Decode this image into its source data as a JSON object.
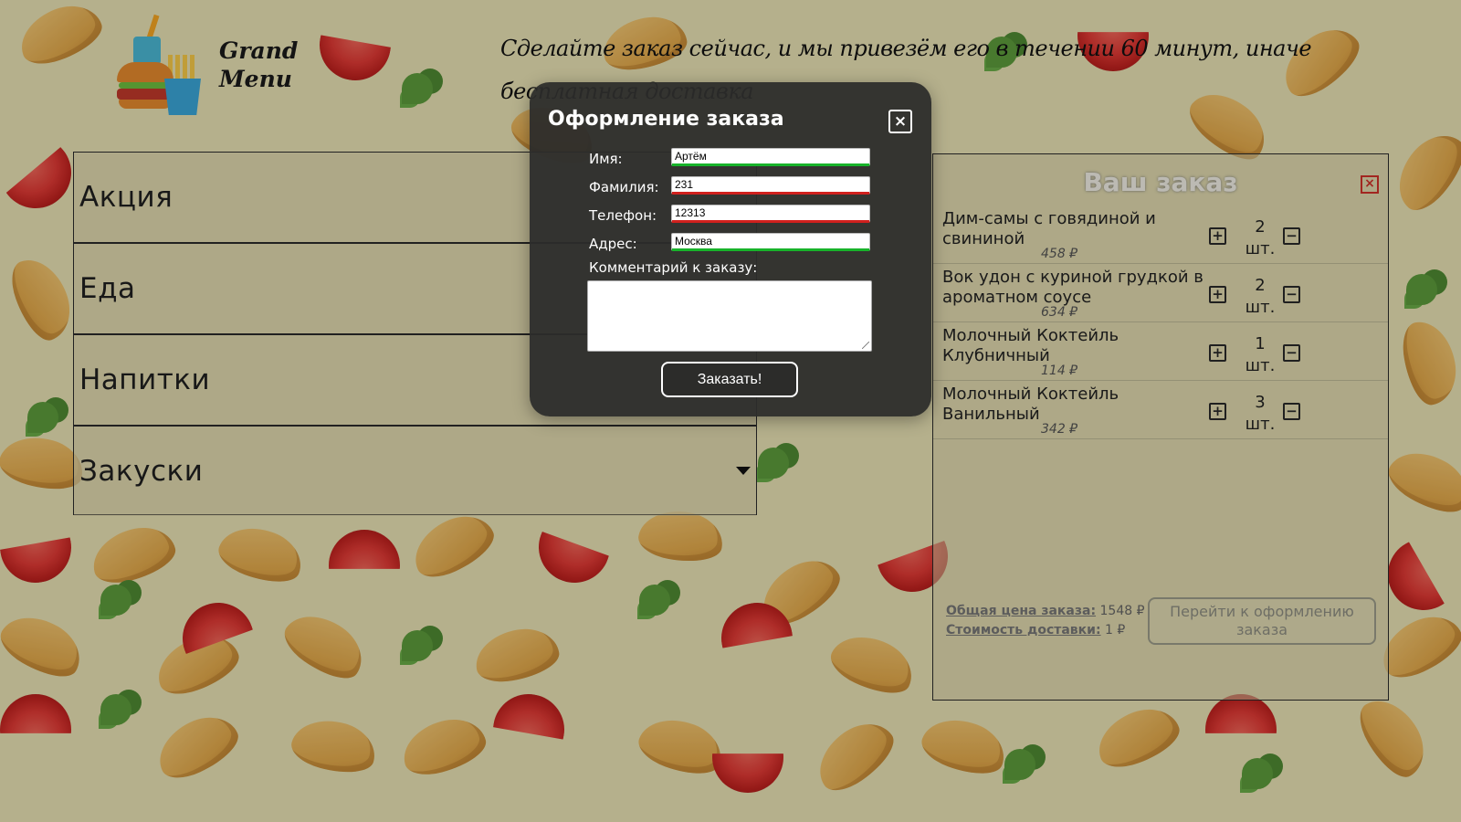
{
  "header": {
    "brand": "Grand Menu",
    "slogan": "Сделайте заказ сейчас, и мы привезём его в течении 60 минут, иначе бесплатная доставка"
  },
  "categories": [
    {
      "label": "Акция"
    },
    {
      "label": "Еда"
    },
    {
      "label": "Напитки"
    },
    {
      "label": "Закуски"
    }
  ],
  "order": {
    "title": "Ваш заказ",
    "close_icon": "close-icon",
    "items": [
      {
        "name": "Дим-самы с говядиной и свининой",
        "qty": "2",
        "unit": "шт.",
        "price": "458 ₽"
      },
      {
        "name": "Вок удон с куриной грудкой в ароматном соусе",
        "qty": "2",
        "unit": "шт.",
        "price": "634 ₽"
      },
      {
        "name": "Молочный Коктейль Клубничный",
        "qty": "1",
        "unit": "шт.",
        "price": "114 ₽"
      },
      {
        "name": "Молочный Коктейль Ванильный",
        "qty": "3",
        "unit": "шт.",
        "price": "342 ₽"
      }
    ],
    "total_label": "Общая цена заказа:",
    "total_value": "1548 ₽",
    "delivery_label": "Стоимость доставки:",
    "delivery_value": "1 ₽",
    "checkout_label": "Перейти к оформлению заказа"
  },
  "modal": {
    "title": "Оформление заказа",
    "fields": {
      "name": {
        "label": "Имя:",
        "value": "Артём",
        "valid": true
      },
      "surname": {
        "label": "Фамилия:",
        "value": "231",
        "valid": false
      },
      "phone": {
        "label": "Телефон:",
        "value": "12313",
        "valid": false
      },
      "address": {
        "label": "Адрес:",
        "value": "Москва",
        "valid": true
      }
    },
    "comment_label": "Комментарий к заказу:",
    "comment_value": "",
    "submit_label": "Заказать!"
  },
  "colors": {
    "valid": "#17b32a",
    "invalid": "#d0201d",
    "modal_bg": "#2c2c2a"
  }
}
